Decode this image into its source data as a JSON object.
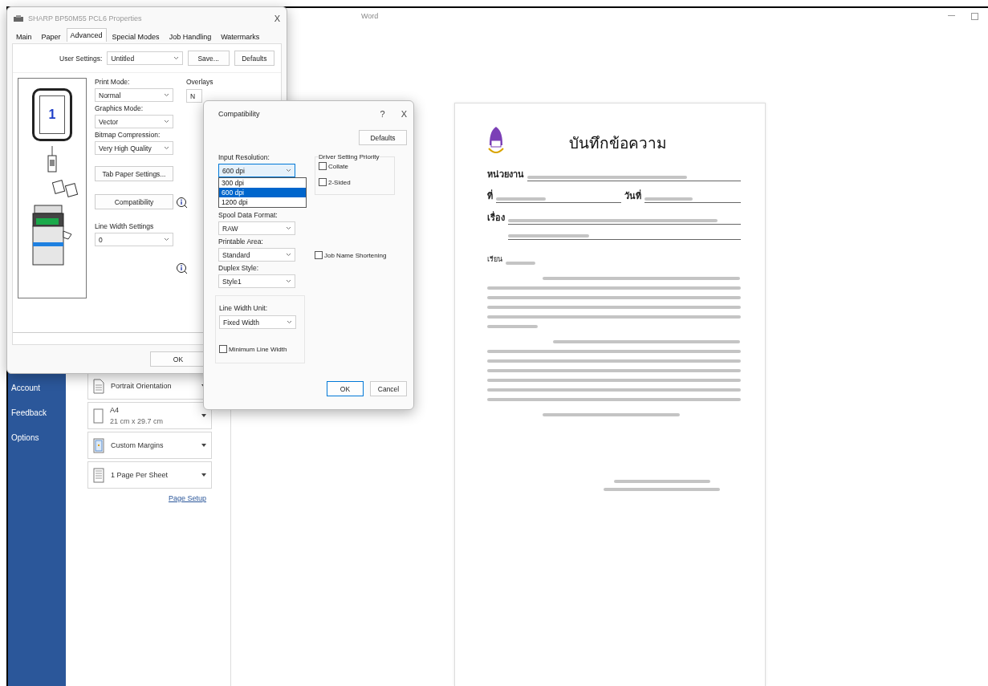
{
  "word_window": {
    "title": "Word"
  },
  "backstage_nav": [
    {
      "label": "Account"
    },
    {
      "label": "Feedback"
    },
    {
      "label": "Options"
    }
  ],
  "print_settings": [
    {
      "kind": "orientation",
      "label": "Portrait Orientation"
    },
    {
      "kind": "paper",
      "label": "A4",
      "detail": "21 cm x 29.7 cm"
    },
    {
      "kind": "margins",
      "label": "Custom Margins"
    },
    {
      "kind": "pages",
      "label": "1 Page Per Sheet"
    }
  ],
  "page_setup_link": "Page Setup",
  "document": {
    "title": "บันทึกข้อความ",
    "agency_label": "หน่วยงาน",
    "ref_label": "ที่",
    "date_label": "วันที่",
    "subject_label": "เรื่อง",
    "salutation": "เรียน"
  },
  "properties_dialog": {
    "title": "SHARP BP50M55 PCL6 Properties",
    "close": "X",
    "tabs": [
      {
        "label": "Main",
        "selected": false
      },
      {
        "label": "Paper",
        "selected": false
      },
      {
        "label": "Advanced",
        "selected": true
      },
      {
        "label": "Special Modes",
        "selected": false
      },
      {
        "label": "Job Handling",
        "selected": false
      },
      {
        "label": "Watermarks",
        "selected": false
      }
    ],
    "user_settings": {
      "label": "User Settings:",
      "value": "Untitled"
    },
    "save_button": "Save...",
    "defaults_button": "Defaults",
    "page_number": "1",
    "selects": [
      {
        "label": "Print Mode:",
        "value": "Normal"
      },
      {
        "label": "Graphics Mode:",
        "value": "Vector"
      },
      {
        "label": "Bitmap Compression:",
        "value": "Very High Quality"
      }
    ],
    "tab_paper_button": "Tab Paper Settings...",
    "compatibility_button": "Compatibility",
    "line_width": {
      "label": "Line Width Settings",
      "value": "0"
    },
    "overlays_label": "Overlays",
    "overlays_value": "N",
    "ok_button": "OK"
  },
  "compatibility_dialog": {
    "title": "Compatibility",
    "help": "?",
    "close": "X",
    "defaults_button": "Defaults",
    "input_resolution": {
      "label": "Input Resolution:",
      "value": "600 dpi",
      "expanded": true,
      "options": [
        {
          "label": "300 dpi",
          "selected": false
        },
        {
          "label": "600 dpi",
          "selected": true
        },
        {
          "label": "1200 dpi",
          "selected": false
        }
      ]
    },
    "selects": [
      {
        "label": "Spool Data Format:",
        "value": "RAW"
      },
      {
        "label": "Printable Area:",
        "value": "Standard"
      },
      {
        "label": "Duplex Style:",
        "value": "Style1"
      }
    ],
    "driver_priority": {
      "title": "Driver Setting Priority",
      "options": [
        {
          "label": "Collate",
          "checked": false
        },
        {
          "label": "2-Sided",
          "checked": false
        }
      ]
    },
    "job_name_shortening": {
      "label": "Job Name Shortening",
      "checked": false
    },
    "line_width_unit": {
      "label": "Line Width Unit:",
      "value": "Fixed Width"
    },
    "minimum_line_width": {
      "label": "Minimum Line Width",
      "checked": false
    },
    "ok_button": "OK",
    "cancel_button": "Cancel"
  }
}
